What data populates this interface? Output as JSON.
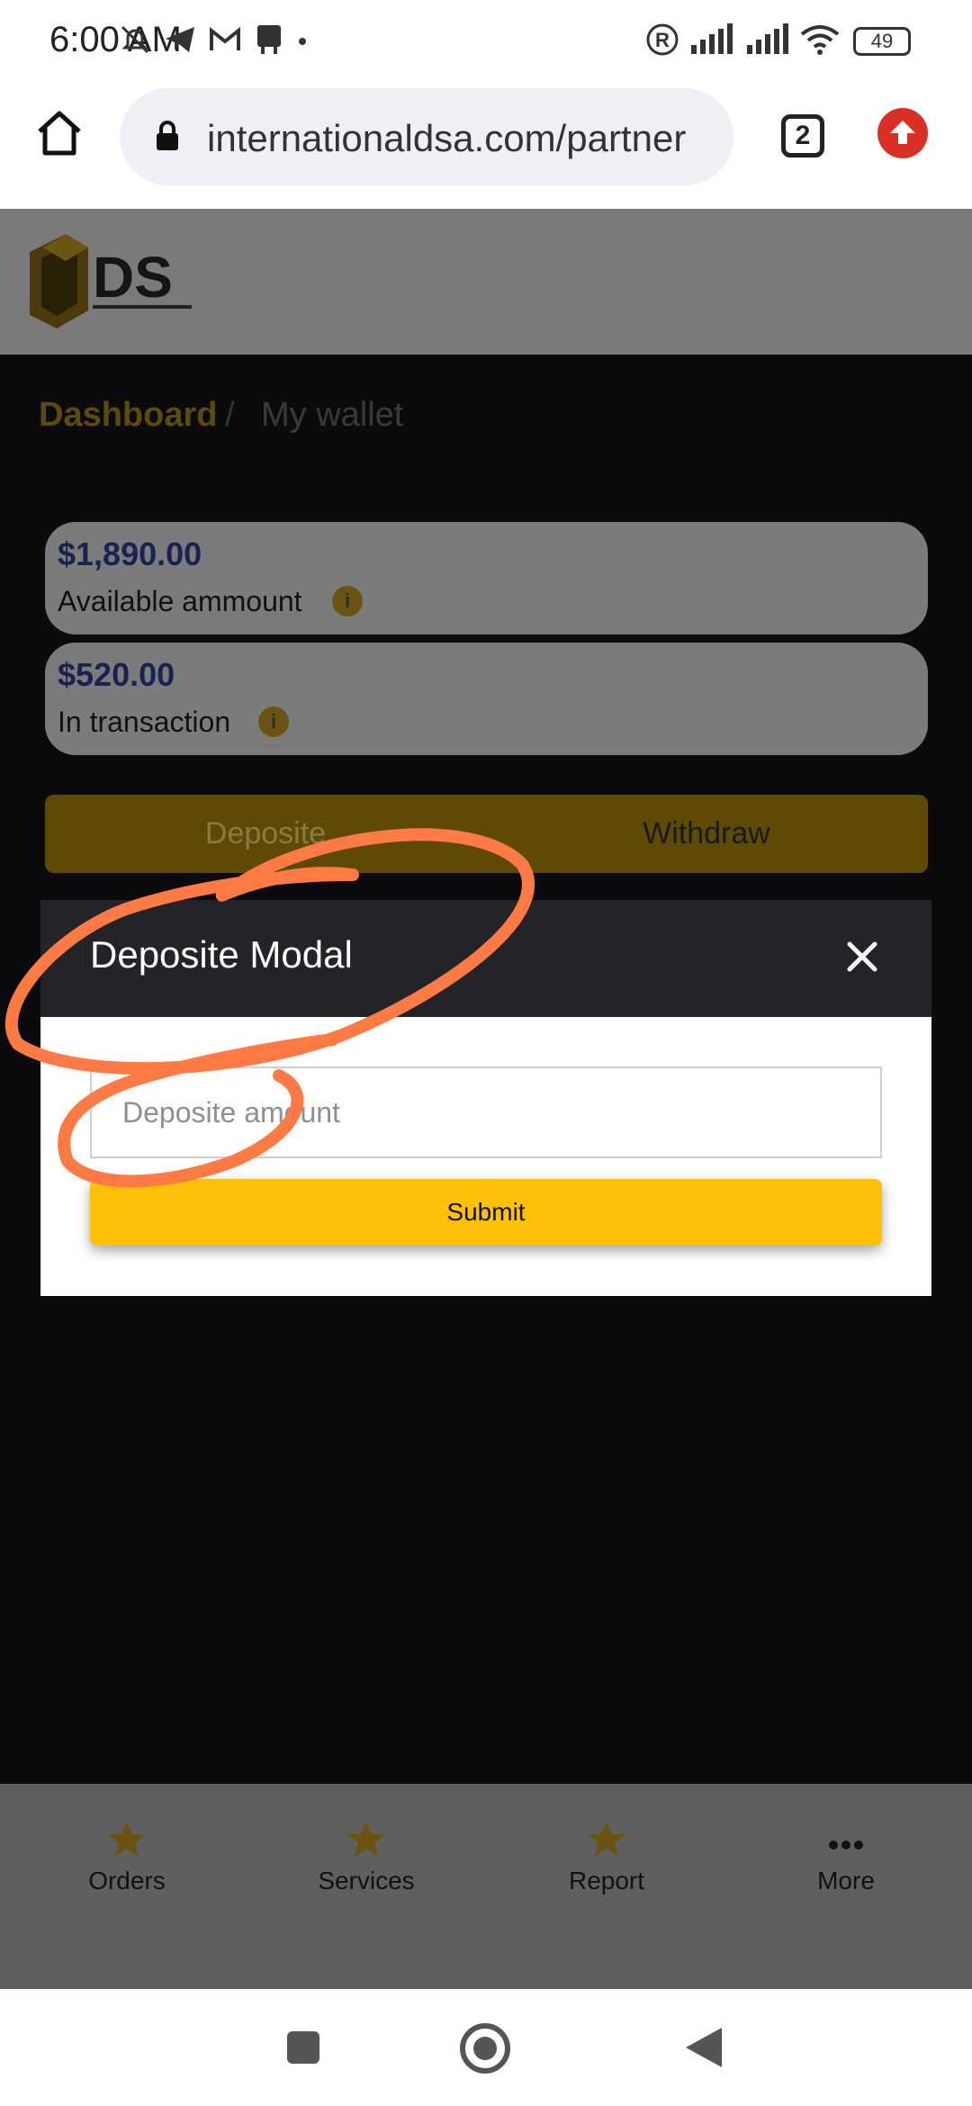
{
  "status_bar": {
    "time": "6:00 AM",
    "battery": "49"
  },
  "browser": {
    "url": "internationaldsa.com/partner",
    "tab_count": "2"
  },
  "site": {
    "logo_text": "DS"
  },
  "breadcrumb": {
    "home": "Dashboard",
    "separator": "/",
    "current": "My wallet"
  },
  "wallet": {
    "available": {
      "amount": "$1,890.00",
      "label": "Available ammount",
      "info": "i"
    },
    "in_transaction": {
      "amount": "$520.00",
      "label": "In transaction",
      "info": "i"
    }
  },
  "actions": {
    "deposite": "Deposite",
    "withdraw": "Withdraw"
  },
  "modal": {
    "title": "Deposite Modal",
    "input_placeholder": "Deposite amount",
    "submit_label": "Submit"
  },
  "bottom_nav": {
    "items": [
      {
        "label": "Orders"
      },
      {
        "label": "Services"
      },
      {
        "label": "Report"
      },
      {
        "label": "More"
      }
    ]
  },
  "colors": {
    "accent": "#ffc107",
    "update": "#d93025",
    "annotation": "#ff7a45"
  }
}
